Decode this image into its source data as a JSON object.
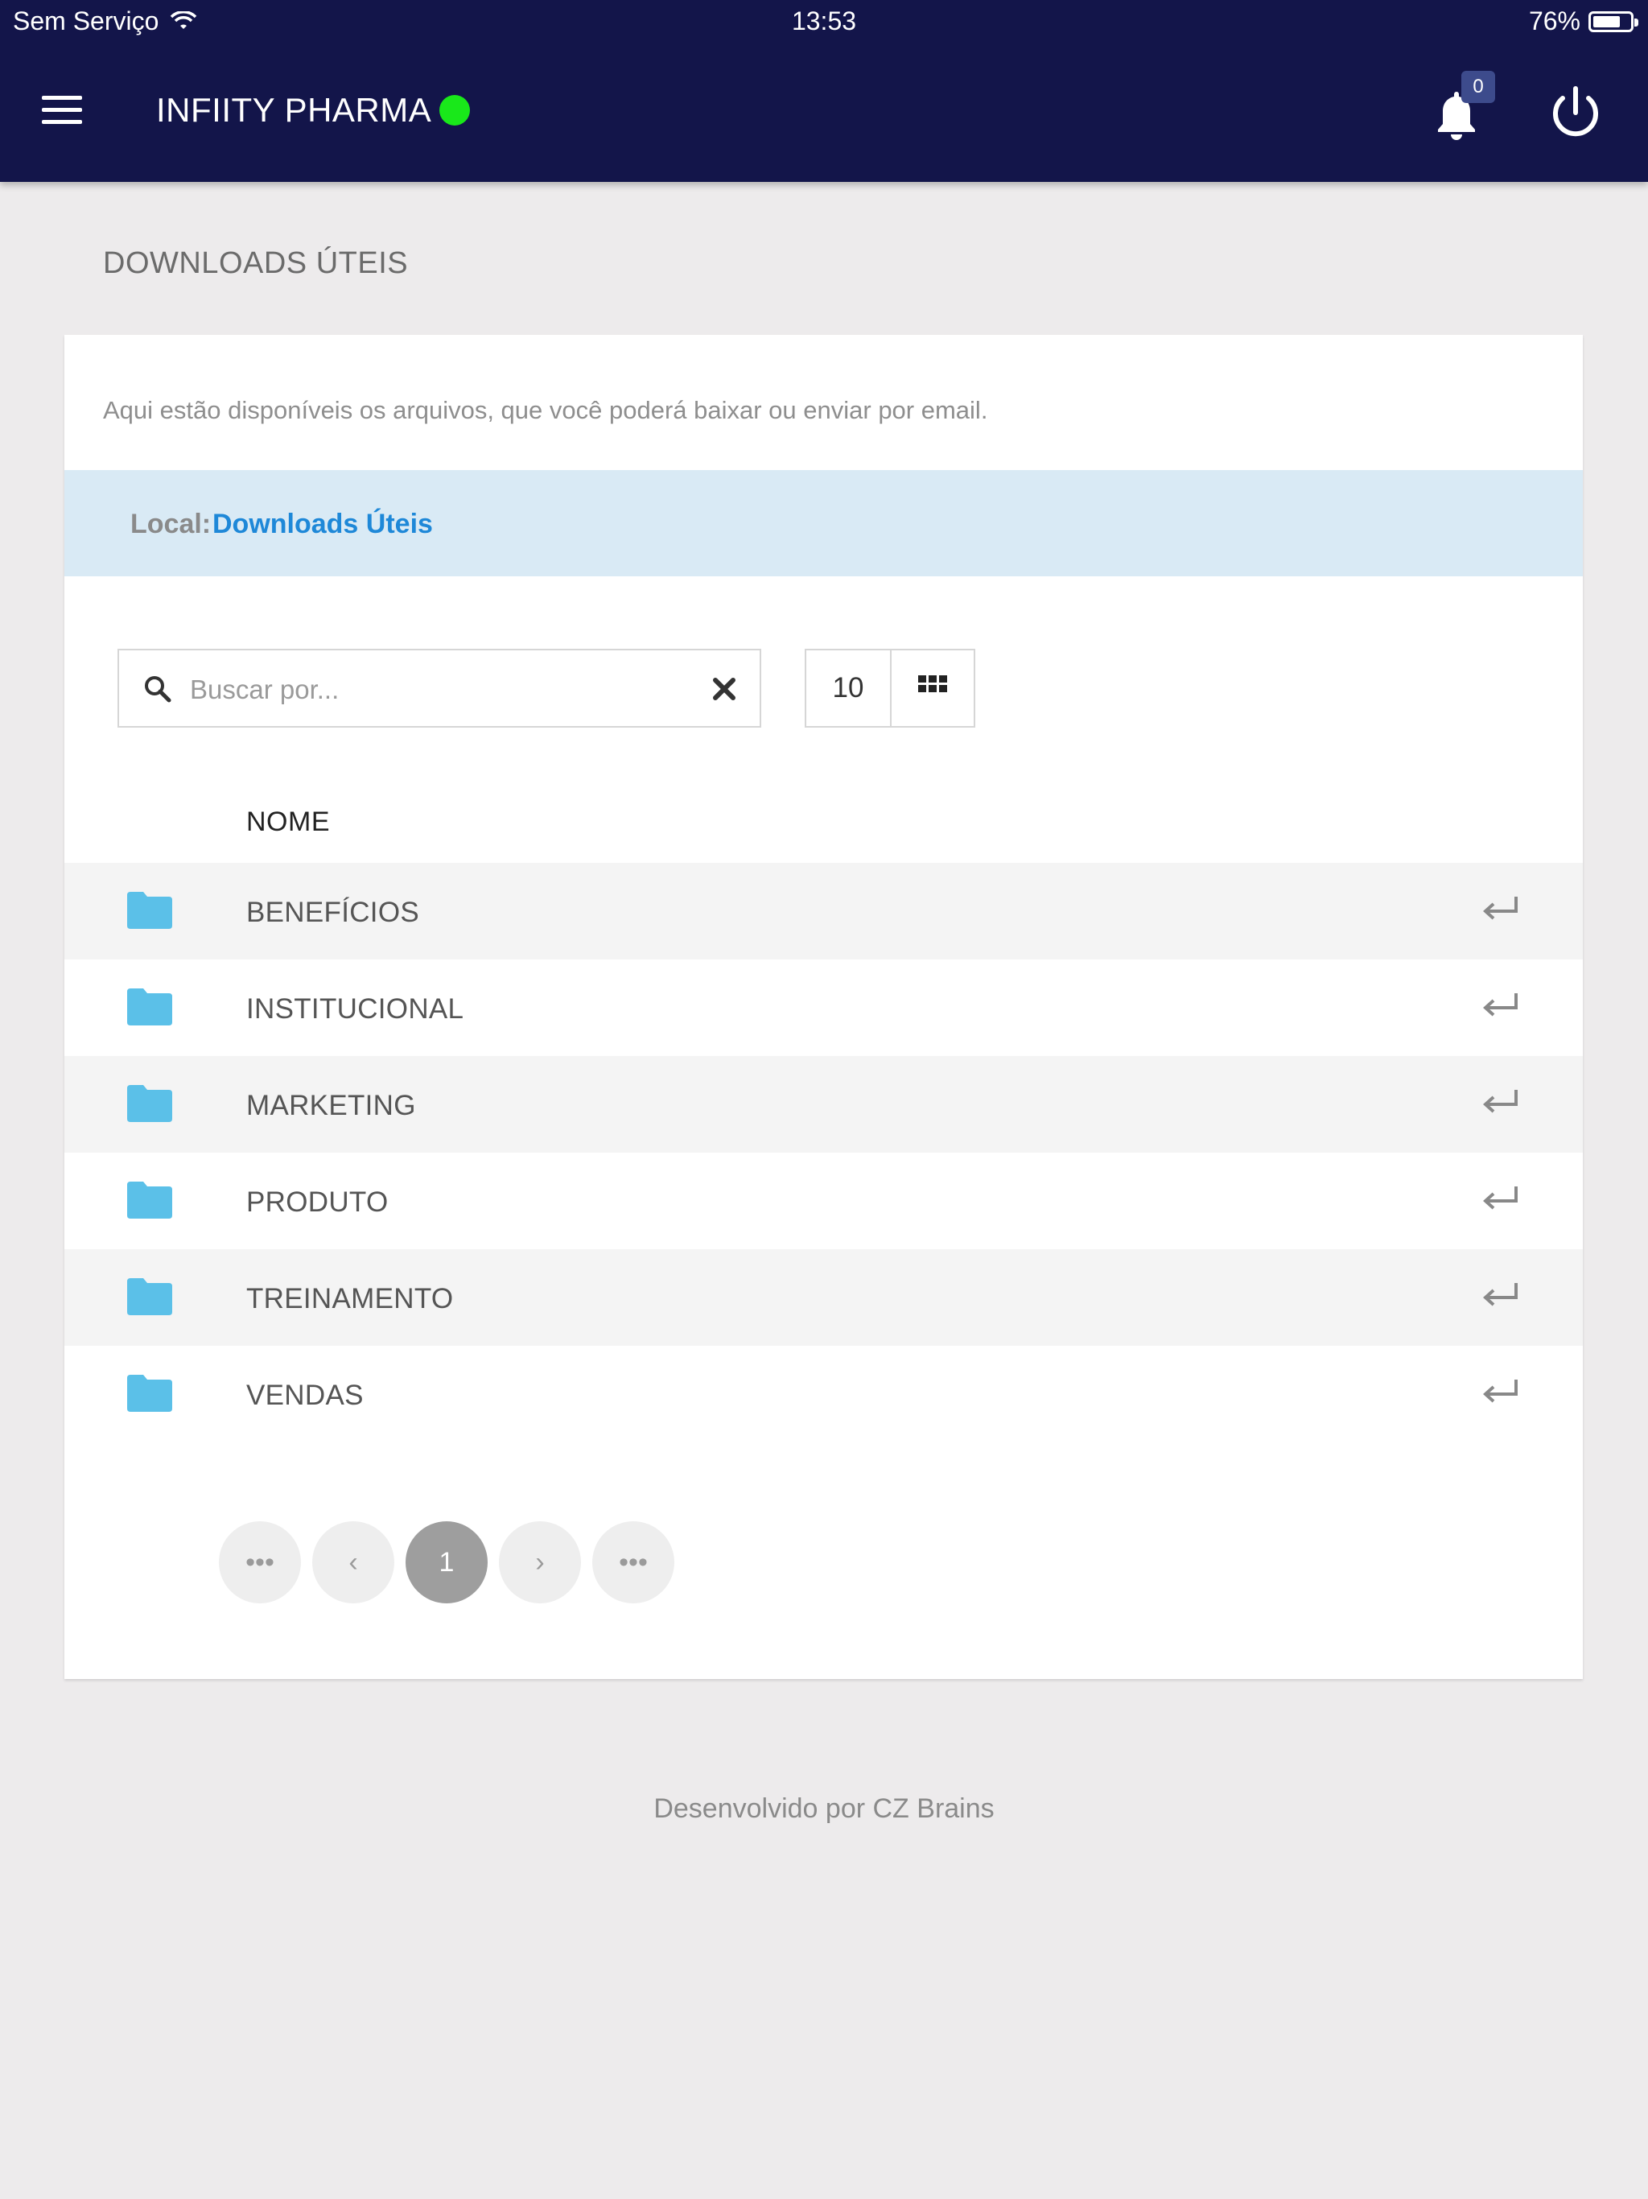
{
  "status_bar": {
    "carrier": "Sem Serviço",
    "time": "13:53",
    "battery_percent_label": "76%",
    "battery_level": 0.76
  },
  "header": {
    "app_title": "INFIITY PHARMA",
    "online_status_color": "#19e81a",
    "notification_count": "0",
    "background_color": "#13154a"
  },
  "page": {
    "title": "DOWNLOADS ÚTEIS",
    "description": "Aqui estão disponíveis os arquivos, que você poderá baixar ou enviar por email."
  },
  "breadcrumb": {
    "label": "Local:",
    "current": "Downloads Úteis"
  },
  "search": {
    "placeholder": "Buscar por...",
    "value": ""
  },
  "page_size": "10",
  "table": {
    "column_name": "NOME",
    "rows": [
      {
        "name": "BENEFÍCIOS",
        "icon": "folder-icon"
      },
      {
        "name": "INSTITUCIONAL",
        "icon": "folder-icon"
      },
      {
        "name": "MARKETING",
        "icon": "folder-icon"
      },
      {
        "name": "PRODUTO",
        "icon": "folder-icon"
      },
      {
        "name": "TREINAMENTO",
        "icon": "folder-icon"
      },
      {
        "name": "VENDAS",
        "icon": "folder-icon"
      }
    ]
  },
  "pagination": {
    "first": "•••",
    "prev": "‹",
    "current": "1",
    "next": "›",
    "last": "•••"
  },
  "footer": "Desenvolvido por CZ Brains",
  "colors": {
    "folder": "#5bc0e8",
    "link": "#1e88d8",
    "breadcrumb_bg": "#d9eaf5"
  }
}
